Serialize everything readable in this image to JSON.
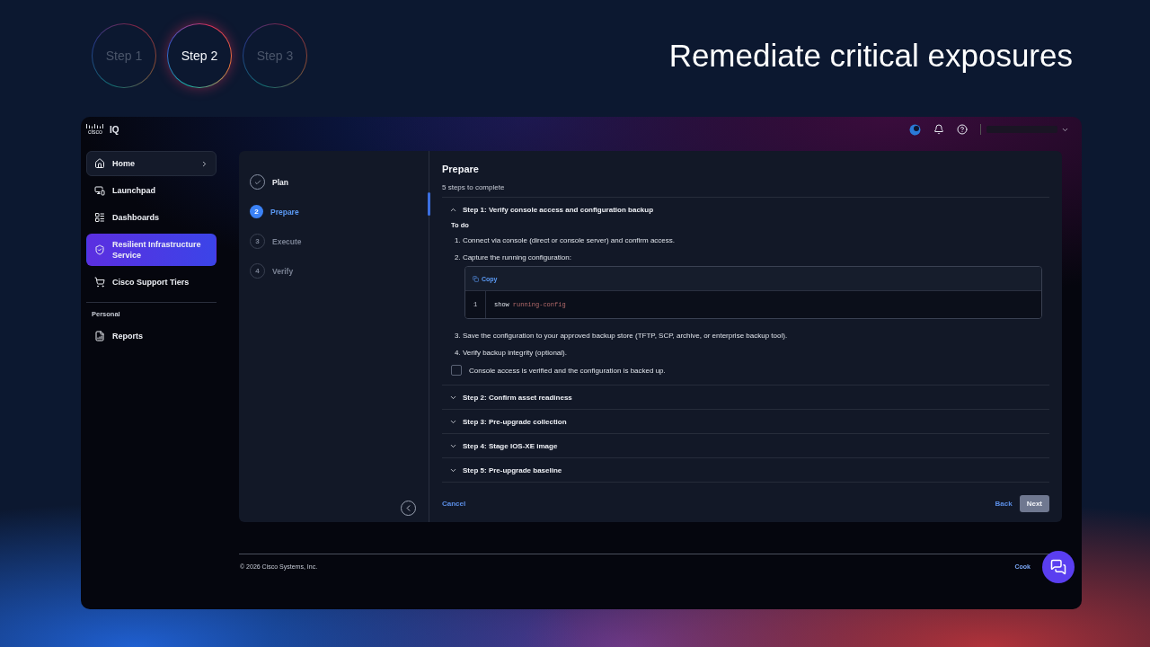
{
  "steps": [
    {
      "label": "Step 1",
      "selected": false
    },
    {
      "label": "Step 2",
      "selected": true
    },
    {
      "label": "Step 3",
      "selected": false
    }
  ],
  "headline": "Remediate critical exposures",
  "app": {
    "brand": {
      "logo_text": "cisco",
      "product": "IQ"
    },
    "sidebar": {
      "items": [
        {
          "label": "Home",
          "selected": false,
          "has_chevron": true
        },
        {
          "label": "Launchpad",
          "selected": false,
          "has_chevron": false
        },
        {
          "label": "Dashboards",
          "selected": false,
          "has_chevron": false
        },
        {
          "label": "Resilient Infrastructure Service",
          "selected": true,
          "has_chevron": false
        },
        {
          "label": "Cisco Support Tiers",
          "selected": false,
          "has_chevron": false
        }
      ],
      "section_label": "Personal",
      "personal_items": [
        {
          "label": "Reports",
          "selected": false,
          "has_chevron": false
        }
      ]
    },
    "wizard": {
      "steps": [
        {
          "label": "Plan",
          "done": true,
          "selected": false
        },
        {
          "number": "2",
          "label": "Prepare",
          "done": false,
          "selected": true
        },
        {
          "number": "3",
          "label": "Execute",
          "done": false,
          "selected": false
        },
        {
          "number": "4",
          "label": "Verify",
          "done": false,
          "selected": false
        }
      ],
      "title": "Prepare",
      "subtitle": "5 steps to complete",
      "sections": [
        {
          "title": "Step 1: Verify console access and configuration backup",
          "expanded": true,
          "todo_label": "To do",
          "items": [
            {
              "kind": "text",
              "text": "1. Connect via console (direct or console server) and confirm access."
            },
            {
              "kind": "text",
              "text": "2. Capture the running configuration:"
            },
            {
              "kind": "code",
              "copy_label": "Copy",
              "lines": [
                {
                  "number": "1",
                  "command": "show",
                  "argument": "running-config"
                }
              ]
            },
            {
              "kind": "text",
              "text": "3. Save the configuration to your approved backup store (TFTP, SCP, archive, or enterprise backup tool)."
            },
            {
              "kind": "text",
              "text": "4. Verify backup integrity (optional)."
            }
          ],
          "confirm": {
            "label": "Console access is verified and the configuration is backed up.",
            "checked": false
          }
        },
        {
          "title": "Step 2: Confirm asset readiness",
          "expanded": false
        },
        {
          "title": "Step 3: Pre-upgrade collection",
          "expanded": false
        },
        {
          "title": "Step 4: Stage IOS-XE image",
          "expanded": false
        },
        {
          "title": "Step 5: Pre-upgrade baseline",
          "expanded": false
        }
      ],
      "cancel": "Cancel",
      "back": "Back",
      "next": {
        "label": "Next",
        "disabled": true
      }
    },
    "footer": {
      "copyright": "© 2026 Cisco Systems, Inc.",
      "link": "Cook"
    }
  }
}
